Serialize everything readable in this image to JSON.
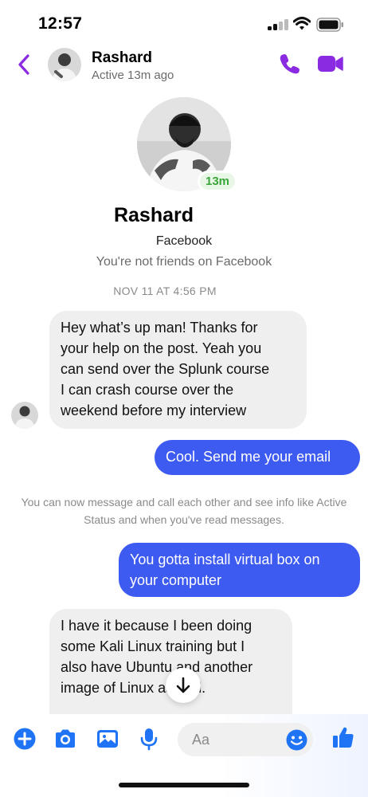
{
  "status_bar": {
    "time": "12:57"
  },
  "header": {
    "name": "Rashard",
    "status": "Active 13m ago"
  },
  "profile": {
    "name": "Rashard",
    "active_badge": "13m",
    "platform": "Facebook",
    "relationship": "You're not friends on Facebook"
  },
  "conversation": {
    "timestamp": "NOV 11 AT 4:56 PM",
    "messages": [
      {
        "from": "them",
        "lines": [
          "Hey what’s up man! Thanks for",
          "your help on the post. Yeah you",
          "can send over the Splunk course",
          "I can crash course over the",
          "weekend before my interview"
        ]
      },
      {
        "from": "me",
        "lines": [
          "Cool. Send me your email"
        ]
      },
      {
        "from": "me",
        "lines": [
          "You gotta install virtual box on",
          "your computer"
        ]
      },
      {
        "from": "them",
        "lines": [
          "I have it because I been doing",
          "some Kali Linux training but I",
          "also have Ubuntu and another",
          "image of Linux as well."
        ]
      }
    ],
    "system_message": "You can now message and call each other and see info like Active Status and when you've read messages."
  },
  "composer": {
    "placeholder": "Aa"
  },
  "colors": {
    "accent": "#8a2be2",
    "outgoing_bubble": "#3d5af1",
    "incoming_bubble": "#efefef",
    "active_green": "#3aa53a"
  },
  "icons": [
    "back-chevron-icon",
    "phone-icon",
    "video-camera-icon",
    "plus-icon",
    "camera-icon",
    "image-icon",
    "microphone-icon",
    "emoji-icon",
    "thumbs-up-icon",
    "arrow-down-icon"
  ]
}
